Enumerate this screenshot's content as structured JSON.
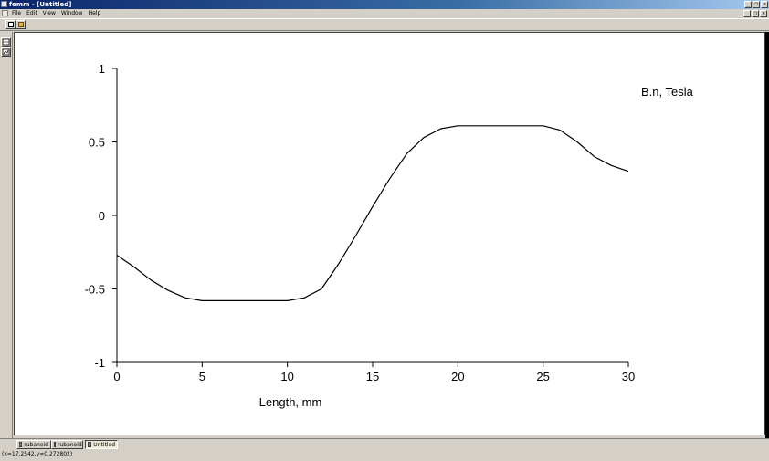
{
  "window": {
    "title": "femm - [Untitled]",
    "menu": [
      "File",
      "Edit",
      "View",
      "Window",
      "Help"
    ],
    "caption_buttons": [
      "_",
      "❐",
      "✕"
    ]
  },
  "tabs": [
    {
      "label": "rubanoid",
      "icon": "magnetics-icon"
    },
    {
      "label": "rubanoid",
      "icon": "output-icon"
    },
    {
      "label": "Untitled",
      "icon": "plot-icon"
    }
  ],
  "status": {
    "text": "(x=17.2542,y=0.272802)"
  },
  "colors": {
    "accent": "#0a246a",
    "plot_background": "#ffffff",
    "curve": "#000000"
  },
  "chart_data": {
    "type": "line",
    "title": "",
    "xlabel": "Length, mm",
    "ylabel": "",
    "legend": "B.n, Tesla",
    "legend_position": "top-right",
    "xlim": [
      0,
      30
    ],
    "ylim": [
      -1,
      1
    ],
    "grid": false,
    "x_ticks": [
      0,
      5,
      10,
      15,
      20,
      25,
      30
    ],
    "y_ticks": [
      1,
      0.5,
      0,
      -0.5,
      -1
    ],
    "x_tick_labels": [
      "0",
      "5",
      "10",
      "15",
      "20",
      "25",
      "30"
    ],
    "y_tick_labels": [
      "1",
      "0.5",
      "0",
      "-0.5",
      "-1"
    ],
    "series": [
      {
        "name": "B.n, Tesla",
        "x": [
          0,
          1,
          2,
          3,
          4,
          5,
          6,
          7,
          8,
          9,
          10,
          11,
          12,
          13,
          14,
          15,
          16,
          17,
          18,
          19,
          20,
          21,
          22,
          23,
          24,
          25,
          26,
          27,
          28,
          29,
          30
        ],
        "y": [
          -0.27,
          -0.35,
          -0.44,
          -0.51,
          -0.56,
          -0.58,
          -0.58,
          -0.58,
          -0.58,
          -0.58,
          -0.58,
          -0.56,
          -0.5,
          -0.33,
          -0.14,
          0.06,
          0.25,
          0.42,
          0.53,
          0.59,
          0.61,
          0.61,
          0.61,
          0.61,
          0.61,
          0.61,
          0.58,
          0.5,
          0.4,
          0.34,
          0.3
        ]
      }
    ]
  }
}
